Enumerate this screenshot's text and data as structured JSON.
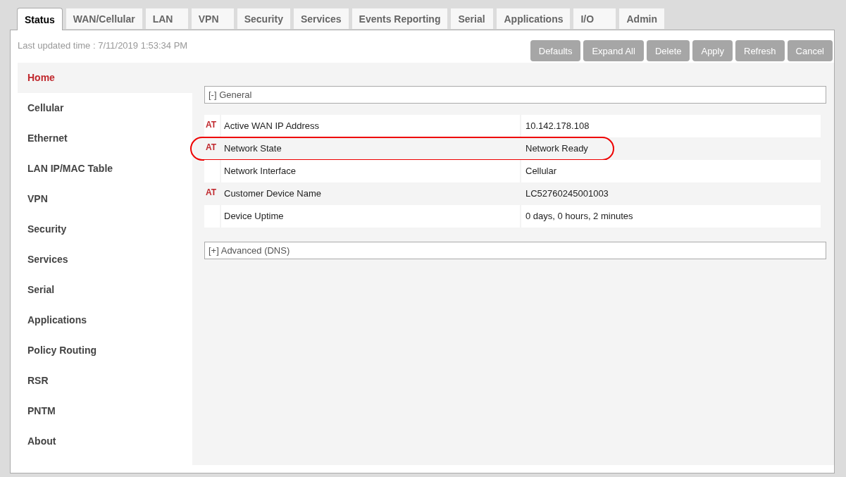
{
  "tabs": [
    {
      "label": "Status",
      "selected": true
    },
    {
      "label": "WAN/Cellular",
      "selected": false
    },
    {
      "label": "LAN",
      "selected": false
    },
    {
      "label": "VPN",
      "selected": false
    },
    {
      "label": "Security",
      "selected": false
    },
    {
      "label": "Services",
      "selected": false
    },
    {
      "label": "Events Reporting",
      "selected": false
    },
    {
      "label": "Serial",
      "selected": false
    },
    {
      "label": "Applications",
      "selected": false
    },
    {
      "label": "I/O",
      "selected": false
    },
    {
      "label": "Admin",
      "selected": false
    }
  ],
  "last_updated": "Last updated time : 7/11/2019 1:53:34 PM",
  "buttons": [
    "Defaults",
    "Expand All",
    "Delete",
    "Apply",
    "Refresh",
    "Cancel"
  ],
  "sidebar": {
    "items": [
      {
        "label": "Home",
        "selected": true
      },
      {
        "label": "Cellular",
        "selected": false
      },
      {
        "label": "Ethernet",
        "selected": false
      },
      {
        "label": "LAN IP/MAC Table",
        "selected": false
      },
      {
        "label": "VPN",
        "selected": false
      },
      {
        "label": "Security",
        "selected": false
      },
      {
        "label": "Services",
        "selected": false
      },
      {
        "label": "Serial",
        "selected": false
      },
      {
        "label": "Applications",
        "selected": false
      },
      {
        "label": "Policy Routing",
        "selected": false
      },
      {
        "label": "RSR",
        "selected": false
      },
      {
        "label": "PNTM",
        "selected": false
      },
      {
        "label": "About",
        "selected": false
      }
    ]
  },
  "sections": [
    {
      "title": "[-] General",
      "rows": [
        {
          "flag": "AT",
          "label": "Active WAN IP Address",
          "value": "10.142.178.108",
          "highlighted": false
        },
        {
          "flag": "AT",
          "label": "Network State",
          "value": "Network Ready",
          "highlighted": true
        },
        {
          "label": "Network Interface",
          "value": "Cellular",
          "highlighted": false
        },
        {
          "flag": "AT",
          "label": "Customer Device Name",
          "value": "LC52760245001003",
          "highlighted": false
        },
        {
          "label": "Device Uptime",
          "value": "0 days, 0 hours, 2 minutes",
          "highlighted": false
        }
      ]
    },
    {
      "title": "[+] Advanced (DNS)"
    }
  ]
}
